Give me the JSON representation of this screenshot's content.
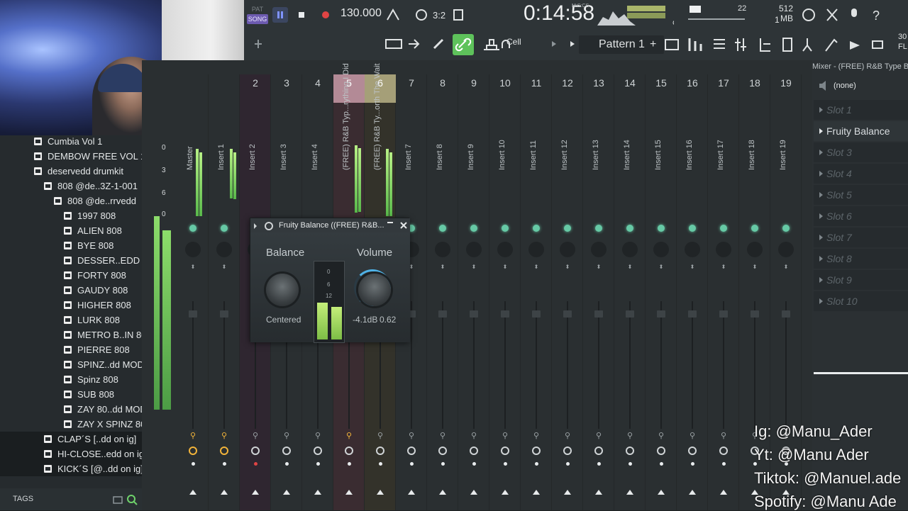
{
  "toolbar": {
    "pat_label": "PAT",
    "song_label": "SONG",
    "tempo": "130.000",
    "time": "0:14:58",
    "time_unit": "M:S:CS",
    "memory": "512 MB",
    "mem_small": "1",
    "polyphony": "22",
    "pattern_name": "Pattern 1",
    "snap_label": "Cell",
    "plus_label": "+",
    "version_top": "30",
    "version_bottom": "FL"
  },
  "browser": {
    "items": [
      {
        "label": "Cumbia Vol 1",
        "indent": 48
      },
      {
        "label": "DEMBOW FREE VOL 1",
        "indent": 48
      },
      {
        "label": "deservedd drumkit",
        "indent": 48
      },
      {
        "label": "808 @de..3Z-1-001",
        "indent": 62
      },
      {
        "label": "808 @de..rrvedd",
        "indent": 76
      },
      {
        "label": "1997 808",
        "indent": 90
      },
      {
        "label": "ALIEN 808",
        "indent": 90
      },
      {
        "label": "BYE 808",
        "indent": 90
      },
      {
        "label": "DESSER..EDD 808",
        "indent": 90
      },
      {
        "label": "FORTY 808",
        "indent": 90
      },
      {
        "label": "GAUDY 808",
        "indent": 90
      },
      {
        "label": "HIGHER 808",
        "indent": 90
      },
      {
        "label": "LURK 808",
        "indent": 90
      },
      {
        "label": "METRO B..IN 808",
        "indent": 90
      },
      {
        "label": "PIERRE 808",
        "indent": 90
      },
      {
        "label": "SPINZ..dd MOD]",
        "indent": 90
      },
      {
        "label": "Spinz 808",
        "indent": 90
      },
      {
        "label": "SUB 808",
        "indent": 90
      },
      {
        "label": "ZAY 80..dd MOD]",
        "indent": 90
      },
      {
        "label": "ZAY X SPINZ 808",
        "indent": 90
      },
      {
        "label": "CLAP´S [..dd on ig]",
        "indent": 62
      },
      {
        "label": "HI-CLOSE..edd on ig]",
        "indent": 62
      },
      {
        "label": "KICK´S [@..dd on ig]",
        "indent": 62
      }
    ],
    "tags_label": "TAGS"
  },
  "mixer": {
    "meter_scale": [
      "0",
      "3",
      "6",
      "0"
    ],
    "strips": [
      {
        "num": "",
        "label": "Master"
      },
      {
        "num": "",
        "label": "Insert 1"
      },
      {
        "num": "2",
        "label": "Insert 2"
      },
      {
        "num": "3",
        "label": "Insert 3"
      },
      {
        "num": "4",
        "label": "Insert 4"
      },
      {
        "num": "5",
        "label": "(FREE) R&B Typ...rything I Did"
      },
      {
        "num": "6",
        "label": "(FREE) R&B Ty...orth The Wait"
      },
      {
        "num": "7",
        "label": "Insert 7"
      },
      {
        "num": "8",
        "label": "Insert 8"
      },
      {
        "num": "9",
        "label": "Insert 9"
      },
      {
        "num": "10",
        "label": "Insert 10"
      },
      {
        "num": "11",
        "label": "Insert 11"
      },
      {
        "num": "12",
        "label": "Insert 12"
      },
      {
        "num": "13",
        "label": "Insert 13"
      },
      {
        "num": "14",
        "label": "Insert 14"
      },
      {
        "num": "15",
        "label": "Insert 15"
      },
      {
        "num": "16",
        "label": "Insert 16"
      },
      {
        "num": "17",
        "label": "Insert 17"
      },
      {
        "num": "18",
        "label": "Insert 18"
      },
      {
        "num": "19",
        "label": "Insert 19"
      }
    ]
  },
  "plugin": {
    "title": "Fruity Balance ((FREE) R&B...",
    "balance_label": "Balance",
    "balance_value": "Centered",
    "volume_label": "Volume",
    "volume_db": "-4.1dB",
    "volume_value": "0.62",
    "meter_scale": [
      "0",
      "6",
      "12"
    ]
  },
  "right_panel": {
    "header": "Mixer - (FREE) R&B Type B",
    "preset": "(none)",
    "slots": [
      {
        "label": "Slot 1",
        "active": false
      },
      {
        "label": "Fruity Balance",
        "active": true
      },
      {
        "label": "Slot 3",
        "active": false
      },
      {
        "label": "Slot 4",
        "active": false
      },
      {
        "label": "Slot 5",
        "active": false
      },
      {
        "label": "Slot 6",
        "active": false
      },
      {
        "label": "Slot 7",
        "active": false
      },
      {
        "label": "Slot 8",
        "active": false
      },
      {
        "label": "Slot 9",
        "active": false
      },
      {
        "label": "Slot 10",
        "active": false
      }
    ]
  },
  "overlay": {
    "ig": "Ig: @Manu_Ader",
    "yt": "Yt: @Manu Ader",
    "tiktok": "Tiktok: @Manuel.ade",
    "spotify": "Spotify: @Manu Ade"
  },
  "colors": {
    "accent_green": "#5ec25b",
    "meter_green": "#8cdc6a",
    "song_purple": "#6d5bb0",
    "knob_blue": "#4fb2e6",
    "insert5_pink": "#b38a96",
    "insert6_olive": "#a59f78"
  }
}
